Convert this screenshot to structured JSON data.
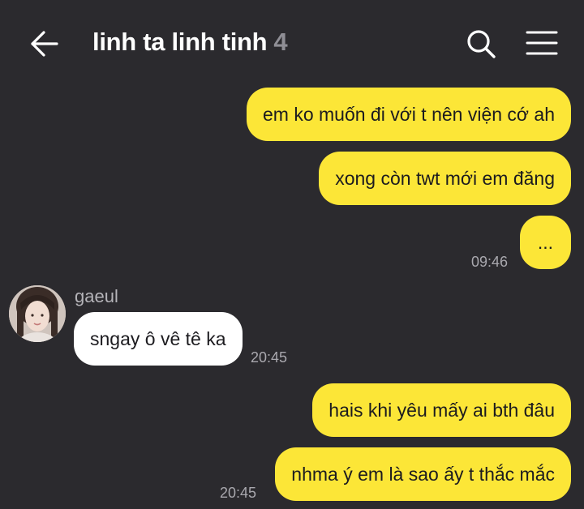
{
  "header": {
    "back_icon": "arrow-left-icon",
    "title": "linh ta linh tinh",
    "member_count": "4",
    "search_icon": "search-icon",
    "menu_icon": "hamburger-menu-icon"
  },
  "colors": {
    "background": "#2b2a2e",
    "my_bubble": "#fce637",
    "other_bubble": "#ffffff",
    "timestamp": "#a9a8ae"
  },
  "messages": [
    {
      "from": "me",
      "text": "em ko muốn đi với t nên viện cớ ah"
    },
    {
      "from": "me",
      "text": "xong còn twt mới em đăng"
    },
    {
      "from": "me",
      "text": "...",
      "time": "09:46"
    },
    {
      "from": "other",
      "sender": "gaeul",
      "text": "sngay ô vê tê ka",
      "time": "20:45"
    },
    {
      "from": "me",
      "text": "hais khi yêu mấy ai bth đâu"
    },
    {
      "from": "me",
      "text": "nhma ý em là sao ấy t thắc mắc",
      "time": "20:45"
    }
  ]
}
